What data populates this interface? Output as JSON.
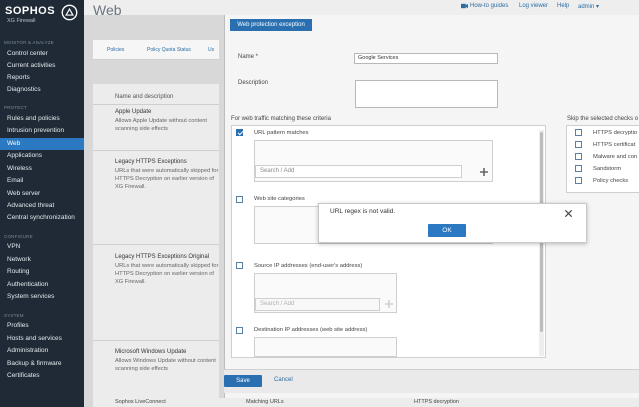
{
  "brand": {
    "logo": "SOPHOS",
    "product": "XG Firewall"
  },
  "sidebar": {
    "sections": [
      {
        "title": "MONITOR & ANALYZE",
        "items": [
          "Control center",
          "Current activities",
          "Reports",
          "Diagnostics"
        ]
      },
      {
        "title": "PROTECT",
        "items": [
          "Rules and policies",
          "Intrusion prevention",
          "Web",
          "Applications",
          "Wireless",
          "Email",
          "Web server",
          "Advanced threat",
          "Central synchronization"
        ]
      },
      {
        "title": "CONFIGURE",
        "items": [
          "VPN",
          "Network",
          "Routing",
          "Authentication",
          "System services"
        ]
      },
      {
        "title": "SYSTEM",
        "items": [
          "Profiles",
          "Hosts and services",
          "Administration",
          "Backup & firmware",
          "Certificates"
        ]
      }
    ],
    "active_item": "Web"
  },
  "topbar": {
    "page_title": "Web",
    "links": [
      "How-to guides",
      "Log viewer",
      "Help",
      "admin ▾"
    ]
  },
  "background": {
    "tabs": [
      "Policies",
      "Policy Quota Status",
      "Us"
    ],
    "column_header": "Name and description",
    "rows": [
      {
        "title": "Apple Update",
        "desc": "Allows Apple Update without content scanning side effects"
      },
      {
        "title": "Legacy HTTPS Exceptions",
        "desc": "URLs that were automatically skipped for HTTPS Decryption on earlier version of XG Firewall."
      },
      {
        "title": "Legacy HTTPS Exceptions Original",
        "desc": "URLs that were automatically skipped for HTTPS Decryption on earlier version of XG Firewall."
      },
      {
        "title": "Microsoft Windows Update",
        "desc": "Allows Windows Update without content scanning side effects"
      }
    ],
    "bottom_row": [
      "Sophos LiveConnect",
      "Matching URLs",
      "HTTPS decryption"
    ]
  },
  "dialog": {
    "title": "Web protection exception",
    "name_label": "Name *",
    "name_value": "Google Services",
    "description_label": "Description",
    "criteria_heading": "For web traffic matching these criteria",
    "criteria": [
      {
        "label": "URL pattern matches",
        "checked": true
      },
      {
        "label": "Web site categories",
        "checked": false
      },
      {
        "label": "Source IP addresses (end-user's address)",
        "checked": false
      },
      {
        "label": "Destination IP addresses (web site address)",
        "checked": false
      }
    ],
    "search_placeholder": "Search / Add",
    "skip_heading": "Skip the selected checks o",
    "skip_checks": [
      "HTTPS decryptio",
      "HTTPS certificat",
      "Malware and con",
      "Sandstorm",
      "Policy checks"
    ],
    "save_label": "Save",
    "cancel_label": "Cancel"
  },
  "alert": {
    "message": "URL regex is not valid.",
    "ok_label": "OK"
  },
  "colors": {
    "sidebar": "#1f2a36",
    "accent": "#2a6fb0",
    "active": "#2a79c2"
  }
}
